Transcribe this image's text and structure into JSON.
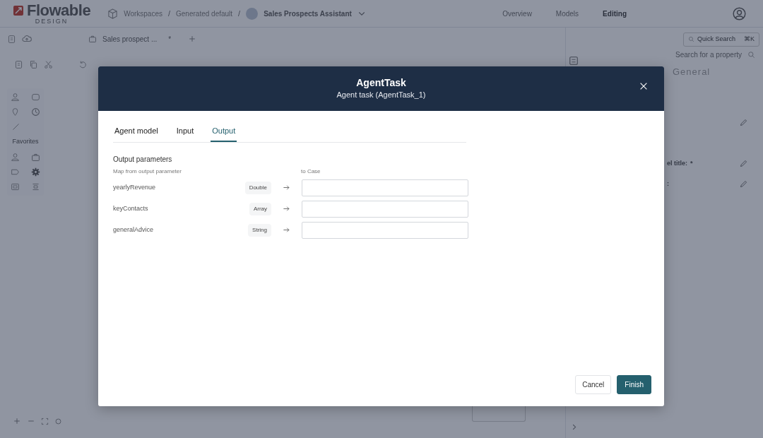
{
  "app": {
    "logo": {
      "name": "Flowable",
      "sub": "DESIGN"
    },
    "breadcrumb_separator": "/",
    "breadcrumb": [
      {
        "label": "Workspaces"
      },
      {
        "label": "Generated default"
      },
      {
        "label": "Sales Prospects Assistant"
      }
    ],
    "nav": [
      {
        "label": "Overview",
        "selected": false
      },
      {
        "label": "Models",
        "selected": false
      },
      {
        "label": "Editing",
        "selected": true
      }
    ],
    "editor_tab": {
      "label": "Sales prospect ...",
      "modified_mark": "*"
    },
    "quick_search": {
      "placeholder": "Quick Search",
      "shortcut": "⌘K"
    },
    "palette": {
      "section": "Favorites"
    },
    "properties": {
      "search_placeholder": "Search for a property",
      "section": "General",
      "labels": [
        {
          "text": "el title:",
          "mark": "*"
        },
        {
          "text": ":"
        }
      ]
    }
  },
  "dialog": {
    "title": "AgentTask",
    "subtitle": "Agent task (AgentTask_1)",
    "tabs": [
      {
        "label": "Agent model",
        "selected": false
      },
      {
        "label": "Input",
        "selected": false
      },
      {
        "label": "Output",
        "selected": true
      }
    ],
    "section": "Output parameters",
    "from_header": "Map from output parameter",
    "to_header": "to Case",
    "parameters": [
      {
        "name": "yearlyRevenue",
        "type": "Double"
      },
      {
        "name": "keyContacts",
        "type": "Array"
      },
      {
        "name": "generalAdvice",
        "type": "String"
      }
    ],
    "buttons": [
      {
        "label": "Cancel",
        "kind": "secondary"
      },
      {
        "label": "Finish",
        "kind": "primary"
      }
    ]
  }
}
